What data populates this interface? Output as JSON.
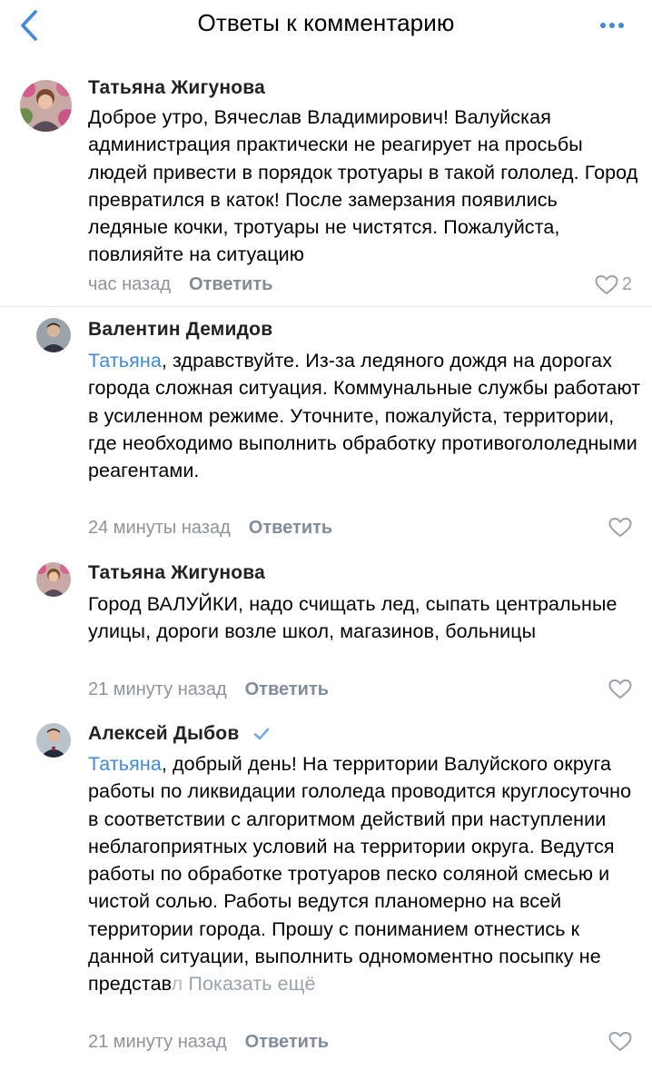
{
  "header": {
    "title": "Ответы к комментарию",
    "back_icon": "chevron-left-icon",
    "more_icon": "more-horizontal-icon",
    "accent": "#3f8ae0"
  },
  "comments": [
    {
      "author": "Татьяна Жигунова",
      "mention": "",
      "text": "Доброе утро, Вячеслав Владимирович! Валуйская администрация практически не реагирует на просьбы людей привести в порядок тротуары в такой гололед. Город превратился в каток! После замерзания появились ледяные кочки, тротуары не чистятся. Пожалуйста, повлияйте на ситуацию",
      "time": "час назад",
      "reply": "Ответить",
      "likes": "2"
    },
    {
      "author": "Валентин Демидов",
      "mention": "Татьяна",
      "text": ", здравствуйте. Из-за ледяного дождя на дорогах города сложная ситуация. Коммунальные службы работают в усиленном режиме. Уточните, пожалуйста, территории, где необходимо выполнить обработку противогололедными реагентами.",
      "time": "24 минуты назад",
      "reply": "Ответить",
      "likes": ""
    },
    {
      "author": "Татьяна Жигунова",
      "mention": "",
      "text": "Город ВАЛУЙКИ, надо счищать лед, сыпать центральные улицы, дороги возле школ, магазинов, больницы",
      "time": "21 минуту назад",
      "reply": "Ответить",
      "likes": ""
    },
    {
      "author": "Алексей Дыбов",
      "verified": true,
      "mention": "Татьяна",
      "text": ", добрый день! На территории Валуйского округа работы по ликвидации гололеда проводится круглосуточно в соответствии с алгоритмом действий при наступлении неблагоприятных условий на территории округа. Ведутся работы по обработке тротуаров песко соляной смесью и чистой солью. Работы ведутся планомерно на всей территории города. Прошу с пониманием отнестись к данной ситуации, выполнить одномоментно посыпку не представ",
      "text_fade": "л",
      "show_more": "Показать ещё",
      "time": "21 минуту назад",
      "reply": "Ответить",
      "likes": ""
    }
  ]
}
